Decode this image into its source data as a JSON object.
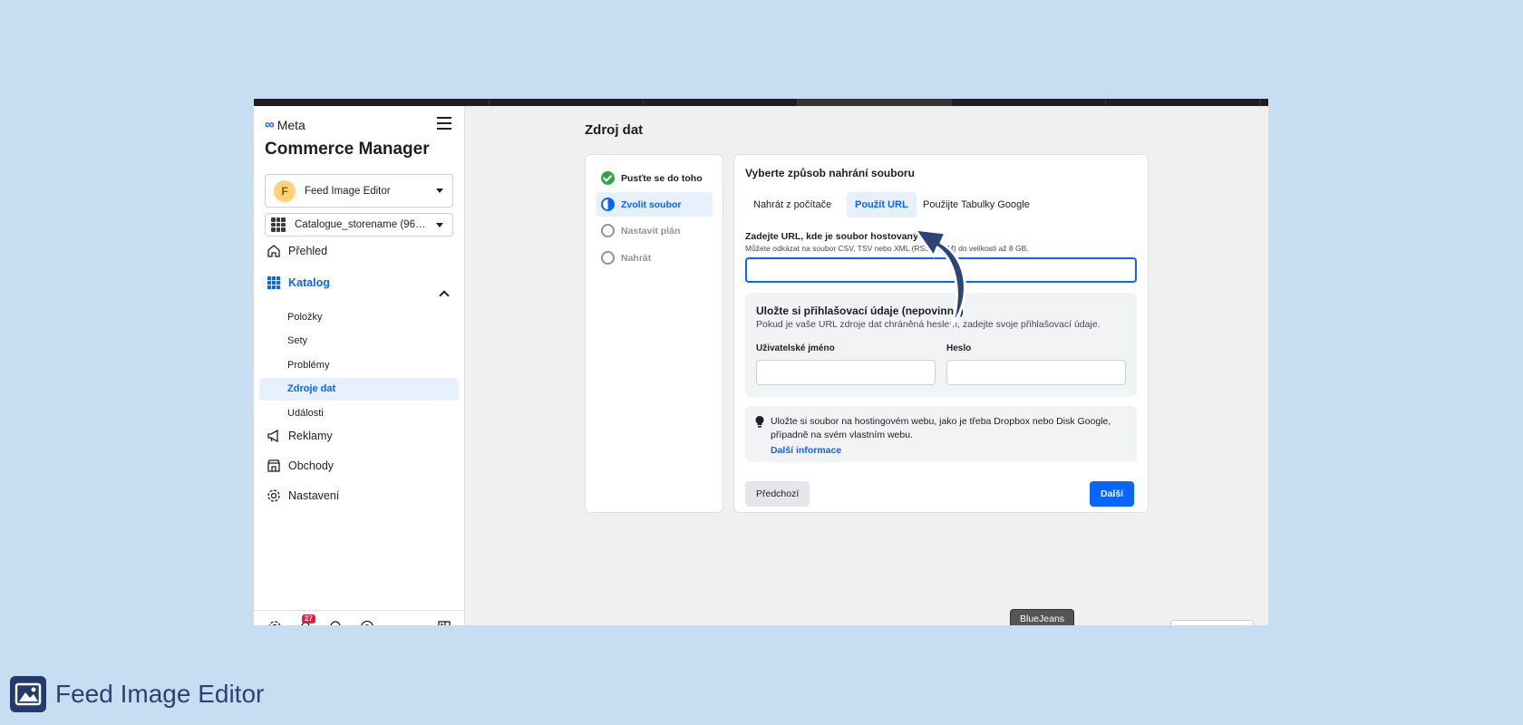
{
  "sidebar": {
    "logo_text": "Meta",
    "app_title": "Commerce Manager",
    "business": {
      "initial": "F",
      "name": "Feed Image Editor"
    },
    "catalog_select": "Catalogue_storename (9669...",
    "nav": {
      "overview": "Přehled",
      "catalog": "Katalog",
      "catalog_items": [
        "Položky",
        "Sety",
        "Problémy",
        "Zdroje dat",
        "Události"
      ],
      "ads": "Reklamy",
      "shops": "Obchody",
      "settings": "Nastavení"
    },
    "notifications_count": "27"
  },
  "main": {
    "page_title": "Zdroj dat",
    "steps": [
      {
        "label": "Pusťte se do toho",
        "state": "done"
      },
      {
        "label": "Zvolit soubor",
        "state": "current"
      },
      {
        "label": "Nastavit plán",
        "state": "todo"
      },
      {
        "label": "Nahrát",
        "state": "todo"
      }
    ],
    "form": {
      "title": "Vyberte způsob nahrání souboru",
      "tabs": [
        "Nahrát z počítače",
        "Použít URL",
        "Použijte Tabulky Google"
      ],
      "active_tab": "Použít URL",
      "url_label": "Zadejte URL, kde je soubor hostovaný",
      "url_hint": "Můžete odkázat na soubor CSV, TSV nebo XML (RSS/ATOM) do velikosti až 8 GB.",
      "url_value": "",
      "credentials": {
        "title": "Uložte si přihlašovací údaje (nepovinné)",
        "description": "Pokud je vaše URL zdroje dat chráněná heslem, zadejte svoje přihlašovací údaje.",
        "username_label": "Uživatelské jméno",
        "password_label": "Heslo"
      },
      "tip": {
        "text": "Uložte si soubor na hostingovém webu, jako je třeba Dropbox nebo Disk Google, případně na svém vlastním webu.",
        "link": "Další informace"
      },
      "prev_button": "Předchozí",
      "next_button": "Další"
    }
  },
  "overlay": {
    "bluejeans_label": "BlueJeans"
  },
  "branding": {
    "name": "Feed Image Editor"
  },
  "colors": {
    "background": "#c7ddf1",
    "accent": "#0866ff",
    "success": "#31a24c",
    "arrow": "#2c4576",
    "brand": "#2a4375"
  }
}
